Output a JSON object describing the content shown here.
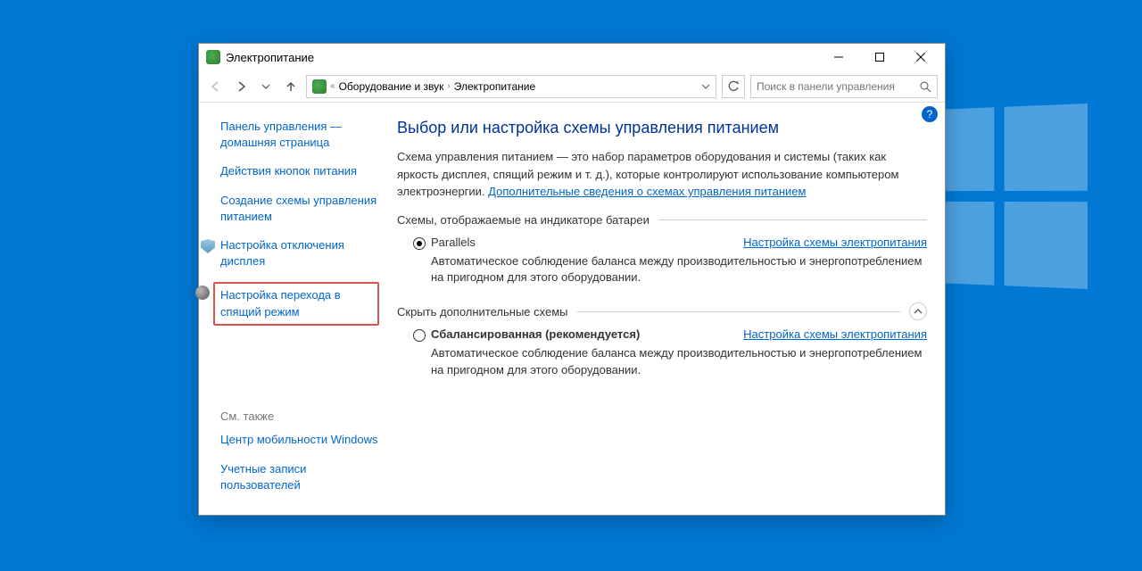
{
  "window": {
    "title": "Электропитание"
  },
  "breadcrumb": {
    "item1": "Оборудование и звук",
    "item2": "Электропитание"
  },
  "search": {
    "placeholder": "Поиск в панели управления"
  },
  "sidebar": {
    "home": "Панель управления — домашняя страница",
    "buttons": "Действия кнопок питания",
    "create_scheme": "Создание схемы управления питанием",
    "display_off": "Настройка отключения дисплея",
    "sleep": "Настройка перехода в спящий режим",
    "see_also": "См. также",
    "mobility": "Центр мобильности Windows",
    "accounts": "Учетные записи пользователей"
  },
  "main": {
    "heading": "Выбор или настройка схемы управления питанием",
    "intro_prefix": "Схема управления питанием — это набор параметров оборудования и системы (таких как яркость дисплея, спящий режим и т. д.), которые контролируют использование компьютером электроэнергии. ",
    "intro_link": "Дополнительные сведения о схемах управления питанием",
    "shown_label": "Схемы, отображаемые на индикаторе батареи",
    "scheme1": {
      "name": "Parallels",
      "settings": "Настройка схемы электропитания",
      "desc": "Автоматическое соблюдение баланса между производительностью и энергопотреблением на пригодном для этого оборудовании."
    },
    "collapse_label": "Скрыть дополнительные схемы",
    "scheme2": {
      "name": "Сбалансированная (рекомендуется)",
      "settings": "Настройка схемы электропитания",
      "desc": "Автоматическое соблюдение баланса между производительностью и энергопотреблением на пригодном для этого оборудовании."
    }
  }
}
